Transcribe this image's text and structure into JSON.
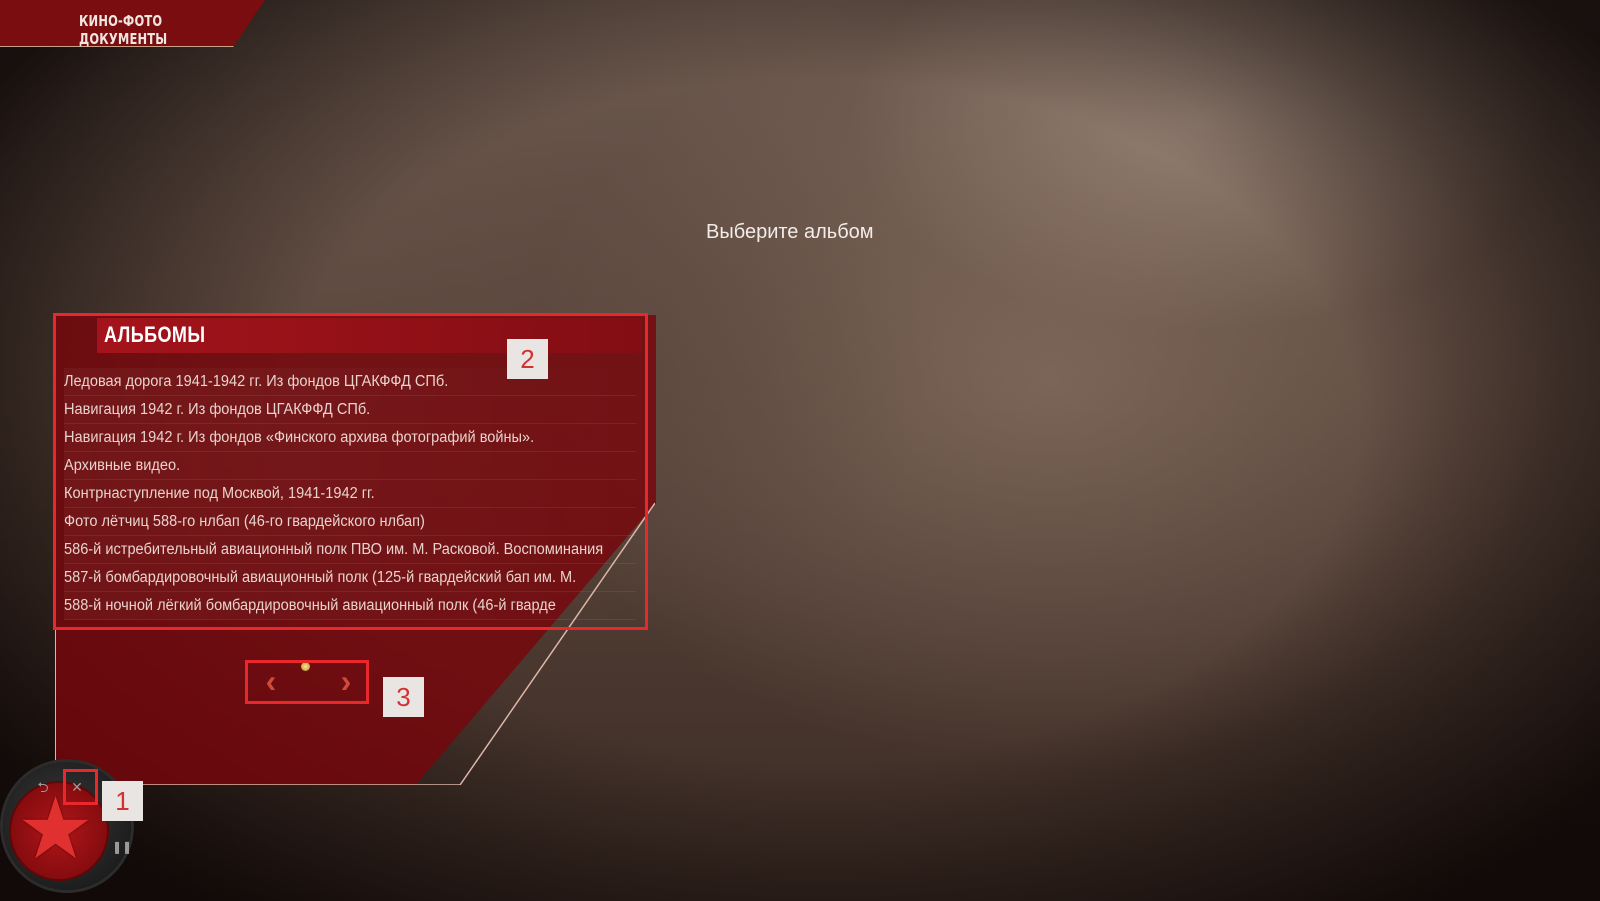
{
  "header": {
    "section_title": "КИНО-ФОТО ДОКУМЕНТЫ"
  },
  "main": {
    "hint": "Выберите альбом"
  },
  "albums_panel": {
    "title": "АЛЬБОМЫ",
    "items": [
      {
        "label": "Ледовая дорога 1941-1942 гг. Из фондов ЦГАКФФД СПб."
      },
      {
        "label": "Навигация 1942 г. Из фондов ЦГАКФФД СПб."
      },
      {
        "label": "Навигация 1942 г. Из фондов «Финского архива фотографий войны»."
      },
      {
        "label": "Архивные видео."
      },
      {
        "label": "Контрнаступление под Москвой, 1941-1942 гг."
      },
      {
        "label": "Фото лётчиц 588-го нлбап (46-го гвардейского нлбап)"
      },
      {
        "label": "586-й истребительный авиационный полк ПВО им. М. Расковой. Воспоминания"
      },
      {
        "label": "587-й бомбардировочный авиационный полк (125-й гвардейский бап им. М."
      },
      {
        "label": "588-й ночной лёгкий бомбардировочный авиационный полк (46-й гварде"
      }
    ],
    "pager": {
      "prev_icon": "‹",
      "next_icon": "›"
    }
  },
  "annotations": {
    "badge_1": "1",
    "badge_2": "2",
    "badge_3": "3"
  },
  "controls": {
    "back_icon": "⮌",
    "close_icon": "✕",
    "pause_icon": "❚❚",
    "star_icon": "★"
  },
  "colors": {
    "panel": "#78060c",
    "accent_red": "#e8282a",
    "text": "#e9d3cc"
  }
}
